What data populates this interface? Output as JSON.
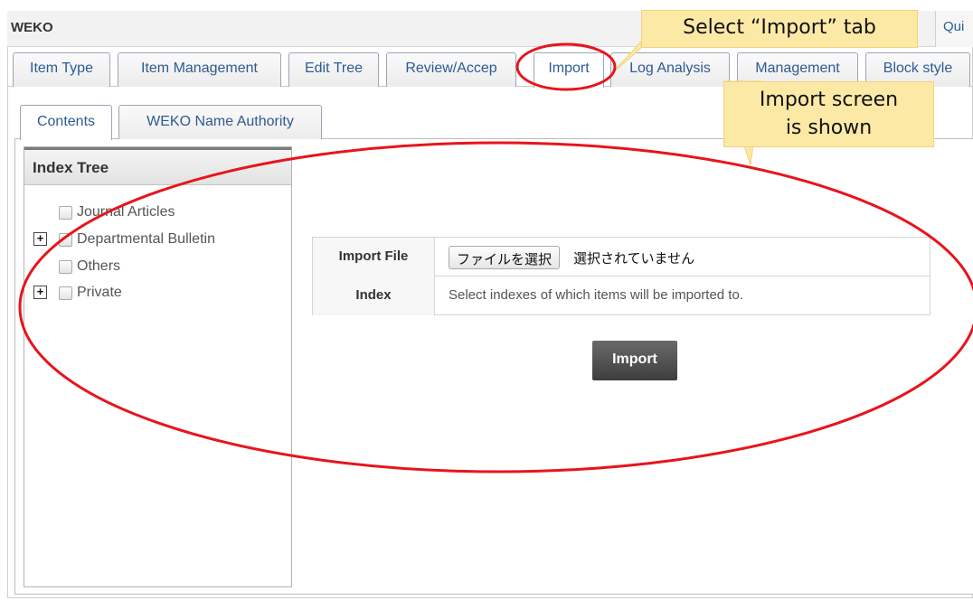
{
  "app": {
    "title": "WEKO",
    "quick_link": "Qui"
  },
  "main_tabs": [
    {
      "label": "Item Type"
    },
    {
      "label": "Item Management"
    },
    {
      "label": "Edit Tree"
    },
    {
      "label": "Review/Accep"
    },
    {
      "label": "Import",
      "active": true
    },
    {
      "label": "Log Analysis"
    },
    {
      "label": "Management"
    },
    {
      "label": "Block style"
    }
  ],
  "sub_tabs": [
    {
      "label": "Contents",
      "active": true
    },
    {
      "label": "WEKO Name Authority"
    }
  ],
  "index_tree": {
    "title": "Index Tree",
    "items": [
      {
        "label": "Journal Articles",
        "expandable": false
      },
      {
        "label": "Departmental Bulletin",
        "expandable": true
      },
      {
        "label": "Others",
        "expandable": false
      },
      {
        "label": "Private",
        "expandable": true
      }
    ],
    "expand_symbol": "+"
  },
  "import_form": {
    "file_label": "Import File",
    "file_button": "ファイルを選択",
    "file_status": "選択されていません",
    "index_label": "Index",
    "index_hint": "Select indexes of which items will be imported to.",
    "import_button": "Import"
  },
  "annotations": {
    "tab_callout": "Select “Import” tab",
    "screen_callout_line1": "Import screen",
    "screen_callout_line2": "is shown",
    "highlight_color": "#e8141c",
    "callout_color": "#fde9a6"
  }
}
